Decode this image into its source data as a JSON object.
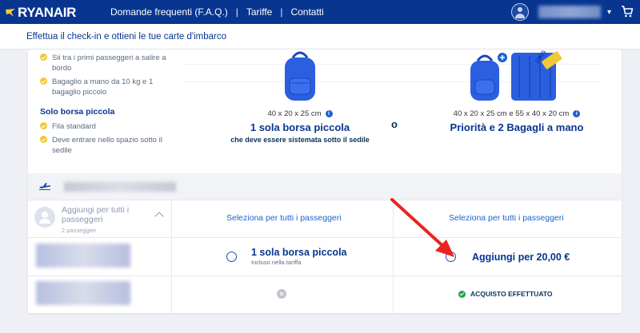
{
  "brand": {
    "name": "RYANAIR"
  },
  "nav": {
    "faq": "Domande frequenti (F.A.Q.)",
    "sep": "|",
    "tariffs": "Tariffe",
    "contacts": "Contatti"
  },
  "subheader": {
    "title": "Effettua il check-in e ottieni le tue carte d'imbarco"
  },
  "priority_benefits": [
    {
      "text": "Sii tra i primi passeggeri a salire a bordo"
    },
    {
      "text": "Bagaglio a mano da 10 kg e 1 bagaglio piccolo"
    }
  ],
  "small_bag_section": {
    "title": "Solo borsa piccola",
    "benefits": [
      {
        "text": "Fila standard"
      },
      {
        "text": "Deve entrare nello spazio sotto il sedile"
      }
    ]
  },
  "options": {
    "small": {
      "dims": "40 x 20 x 25 cm",
      "title": "1 sola borsa piccola",
      "subtitle": "che deve essere sistemata sotto il sedile"
    },
    "priority": {
      "dims": "40 x 20 x 25 cm e 55 x 40 x 20 cm",
      "title": "Priorità e 2 Bagagli a mano",
      "tag": "10KG"
    }
  },
  "all_passengers": {
    "label": "Aggiungi per tutti i passeggeri",
    "count": "2 passeggeri"
  },
  "select_all": {
    "col_small": "Seleziona per tutti i passeggeri",
    "col_priority": "Seleziona per tutti i passeggeri"
  },
  "passenger1": {
    "small_option": "1 sola borsa piccola",
    "included": "Incluso nella tariffa",
    "priority_option": "Aggiungi per 20,00 €"
  },
  "passenger2": {
    "priority_status": "ACQUISTO EFFETTUATO"
  },
  "middle_mark": "o",
  "colors": {
    "navy": "#073590",
    "accent_blue": "#1a62d1",
    "yellow": "#f1c933",
    "green": "#1fa34a",
    "arrow_red": "#e8251f"
  },
  "icons": [
    "ryanair-harp-icon",
    "user-avatar-icon",
    "chevron-down-icon",
    "cart-icon",
    "check-icon",
    "info-icon",
    "plane-icon",
    "group-icon",
    "chevron-up-icon",
    "radio-icon",
    "close-icon",
    "backpack-icon",
    "suitcase-icon",
    "red-arrow-annotation"
  ]
}
